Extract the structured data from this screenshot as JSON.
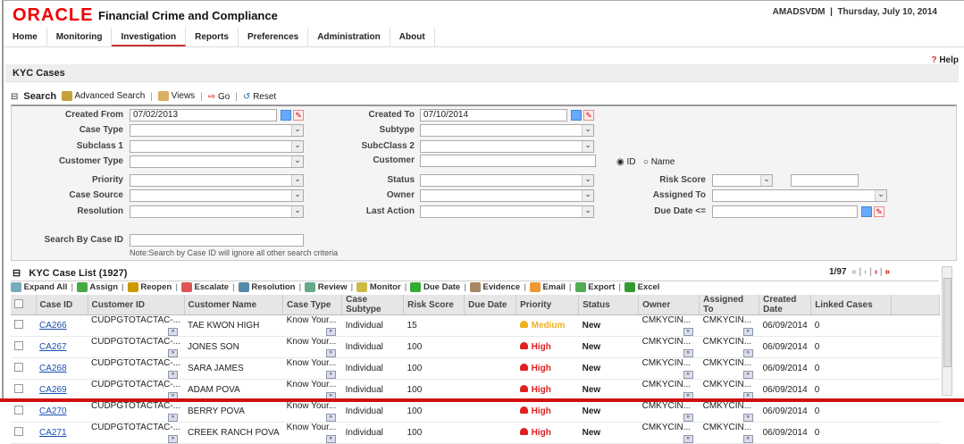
{
  "header": {
    "logo": "ORACLE",
    "app_title": "Financial Crime and Compliance",
    "user": "AMADSVDM",
    "separator": "|",
    "date": "Thursday, July 10, 2014"
  },
  "tabs": [
    "Home",
    "Monitoring",
    "Investigation",
    "Reports",
    "Preferences",
    "Administration",
    "About"
  ],
  "active_tab": "Investigation",
  "help": "Help",
  "section_title": "KYC Cases",
  "search_toolbar": {
    "search": "Search",
    "advanced": "Advanced Search",
    "views": "Views",
    "go": "Go",
    "reset": "Reset"
  },
  "form": {
    "created_from": {
      "label": "Created From",
      "value": "07/02/2013"
    },
    "created_to": {
      "label": "Created To",
      "value": "07/10/2014"
    },
    "case_type": "Case Type",
    "subtype": "Subtype",
    "subclass1": "Subclass 1",
    "subclass2": "SubcClass 2",
    "customer_type": "Customer Type",
    "customer": "Customer",
    "radio_id": "ID",
    "radio_name": "Name",
    "priority": "Priority",
    "status": "Status",
    "risk_score": "Risk Score",
    "case_source": "Case Source",
    "owner": "Owner",
    "assigned_to": "Assigned To",
    "resolution": "Resolution",
    "last_action": "Last Action",
    "due_date": "Due Date <=",
    "search_by_case_id": "Search By Case ID",
    "note": "Note:Search by Case ID will ignore all other search criteria"
  },
  "list": {
    "title": "KYC Case List (1927)",
    "page": "1/97",
    "actions": [
      "Expand All",
      "Assign",
      "Reopen",
      "Escalate",
      "Resolution",
      "Review",
      "Monitor",
      "Due Date",
      "Evidence",
      "Email",
      "Export",
      "Excel"
    ],
    "columns": [
      "Case ID",
      "Customer ID",
      "Customer Name",
      "Case Type",
      "Case Subtype",
      "Risk Score",
      "Due Date",
      "Priority",
      "Status",
      "Owner",
      "Assigned To",
      "Created Date",
      "Linked Cases"
    ],
    "rows": [
      {
        "case_id": "CA266",
        "customer_id": "CUDPGTOTACTAC-...",
        "customer_name": "TAE KWON HIGH",
        "case_type": "Know Your...",
        "subtype": "Individual",
        "risk": "15",
        "due": "",
        "priority": "Medium",
        "status": "New",
        "owner": "CMKYCIN...",
        "assigned": "CMKYCIN...",
        "created": "06/09/2014",
        "linked": "0"
      },
      {
        "case_id": "CA267",
        "customer_id": "CUDPGTOTACTAC-...",
        "customer_name": "JONES SON",
        "case_type": "Know Your...",
        "subtype": "Individual",
        "risk": "100",
        "due": "",
        "priority": "High",
        "status": "New",
        "owner": "CMKYCIN...",
        "assigned": "CMKYCIN...",
        "created": "06/09/2014",
        "linked": "0"
      },
      {
        "case_id": "CA268",
        "customer_id": "CUDPGTOTACTAC-...",
        "customer_name": "SARA JAMES",
        "case_type": "Know Your...",
        "subtype": "Individual",
        "risk": "100",
        "due": "",
        "priority": "High",
        "status": "New",
        "owner": "CMKYCIN...",
        "assigned": "CMKYCIN...",
        "created": "06/09/2014",
        "linked": "0"
      },
      {
        "case_id": "CA269",
        "customer_id": "CUDPGTOTACTAC-...",
        "customer_name": "ADAM POVA",
        "case_type": "Know Your...",
        "subtype": "Individual",
        "risk": "100",
        "due": "",
        "priority": "High",
        "status": "New",
        "owner": "CMKYCIN...",
        "assigned": "CMKYCIN...",
        "created": "06/09/2014",
        "linked": "0"
      },
      {
        "case_id": "CA270",
        "customer_id": "CUDPGTOTACTAC-...",
        "customer_name": "BERRY POVA",
        "case_type": "Know Your...",
        "subtype": "Individual",
        "risk": "100",
        "due": "",
        "priority": "High",
        "status": "New",
        "owner": "CMKYCIN...",
        "assigned": "CMKYCIN...",
        "created": "06/09/2014",
        "linked": "0"
      },
      {
        "case_id": "CA271",
        "customer_id": "CUDPGTOTACTAC-...",
        "customer_name": "CREEK RANCH POVA",
        "case_type": "Know Your...",
        "subtype": "Individual",
        "risk": "100",
        "due": "",
        "priority": "High",
        "status": "New",
        "owner": "CMKYCIN...",
        "assigned": "CMKYCIN...",
        "created": "06/09/2014",
        "linked": "0"
      }
    ]
  },
  "colors": {
    "brand": "#e00000",
    "high": "#e02020",
    "medium": "#f0b020",
    "link": "#1a4fb0"
  }
}
